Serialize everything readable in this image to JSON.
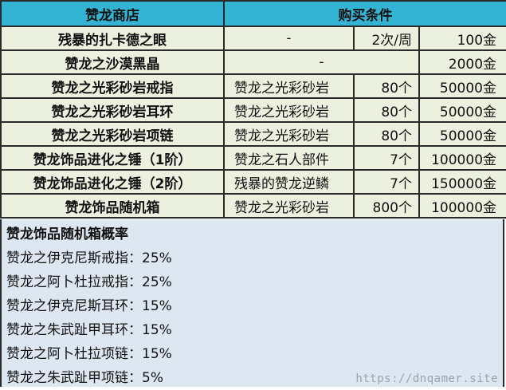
{
  "header": {
    "shop": "赞龙商店",
    "conditions": "购买条件"
  },
  "rows": [
    {
      "name": "残暴的扎卡德之眼",
      "material": "-",
      "qty": "2次/周",
      "price": "100金"
    },
    {
      "name": "赞龙之沙漠黑晶",
      "material": "-",
      "qty": "",
      "price": "2000金"
    },
    {
      "name": "赞龙之光彩砂岩戒指",
      "material": "赞龙之光彩砂岩",
      "qty": "80个",
      "price": "50000金"
    },
    {
      "name": "赞龙之光彩砂岩耳环",
      "material": "赞龙之光彩砂岩",
      "qty": "80个",
      "price": "50000金"
    },
    {
      "name": "赞龙之光彩砂岩项链",
      "material": "赞龙之光彩砂岩",
      "qty": "80个",
      "price": "50000金"
    },
    {
      "name": "赞龙饰品进化之锤（1阶）",
      "material": "赞龙之石人部件",
      "qty": "7个",
      "price": "100000金"
    },
    {
      "name": "赞龙饰品进化之锤（2阶）",
      "material": "残暴的赞龙逆鳞",
      "qty": "7个",
      "price": "150000金"
    },
    {
      "name": "赞龙饰品随机箱",
      "material": "赞龙之光彩砂岩",
      "qty": "800个",
      "price": "100000金"
    }
  ],
  "probability": {
    "title": "赞龙饰品随机箱概率",
    "items": [
      "赞龙之伊克尼斯戒指：25%",
      "赞龙之阿卜杜拉戒指：25%",
      "赞龙之伊克尼斯耳环：15%",
      "赞龙之朱武趾甲耳环：15%",
      "赞龙之阿卜杜拉项链：15%",
      "赞龙之朱武趾甲项链：5%"
    ]
  },
  "watermark": "https://dnqamer.site",
  "colors": {
    "header_bg": "#33b4d4",
    "row_bg": "#ecf0df",
    "prob_bg": "#dde7f2"
  }
}
